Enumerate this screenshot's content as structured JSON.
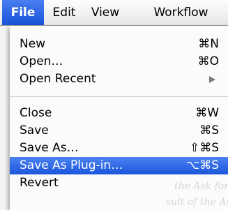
{
  "menubar": {
    "items": [
      {
        "label": "File"
      },
      {
        "label": "Edit"
      },
      {
        "label": "View"
      },
      {
        "label": "Workflow"
      }
    ]
  },
  "menu": {
    "group1": [
      {
        "label": "New",
        "shortcut": "⌘N"
      },
      {
        "label": "Open…",
        "shortcut": "⌘O"
      },
      {
        "label": "Open Recent",
        "submenu_icon": "submenu-arrow-icon"
      }
    ],
    "group2": [
      {
        "label": "Close",
        "shortcut": "⌘W"
      },
      {
        "label": "Save",
        "shortcut": "⌘S"
      },
      {
        "label": "Save As…",
        "shortcut": "⇧⌘S"
      },
      {
        "label": "Save As Plug-in…",
        "shortcut": "⌥⌘S",
        "highlighted": true
      },
      {
        "label": "Revert",
        "shortcut": ""
      }
    ]
  },
  "background_text": {
    "line1": "the Ask for Phot",
    "line2": "sult of the Ask"
  },
  "colors": {
    "highlight": "#1a56dc",
    "menubar_active": "#1552d8"
  }
}
